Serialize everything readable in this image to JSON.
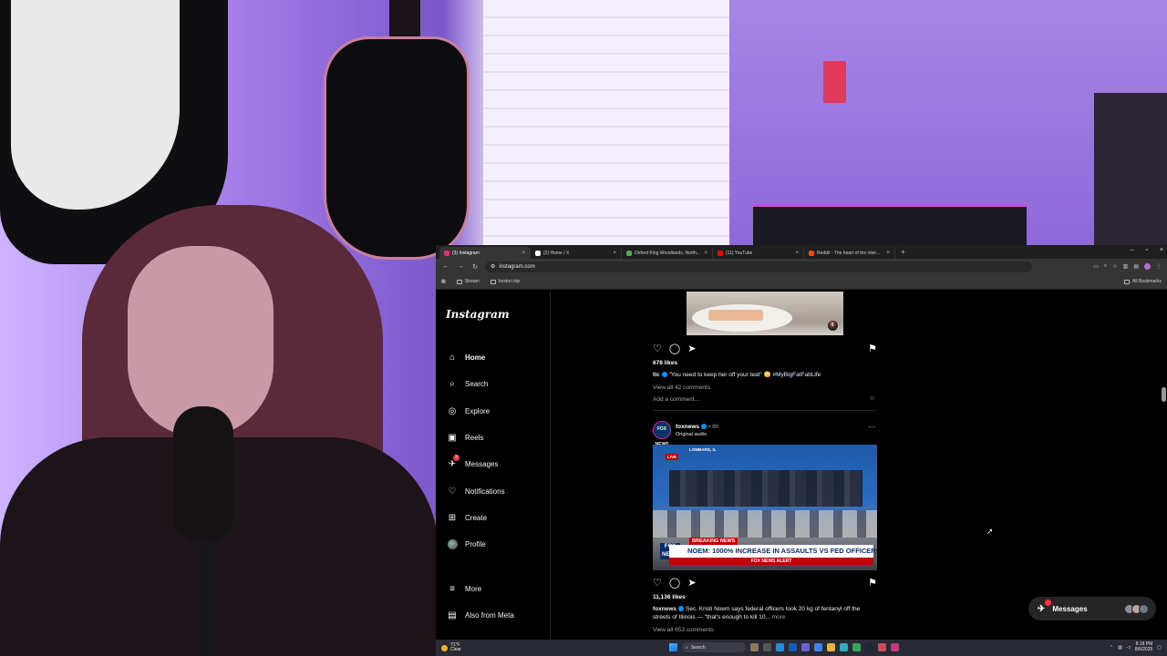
{
  "browser": {
    "tabs": [
      {
        "label": "(3) Instagram",
        "color": "#e1306c",
        "active": true
      },
      {
        "label": "(2) Home / X",
        "color": "#ffffff",
        "active": false
      },
      {
        "label": "Oxford King Woodlands, North...",
        "color": "#4caf50",
        "active": false
      },
      {
        "label": "(11) YouTube",
        "color": "#ff0000",
        "active": false
      },
      {
        "label": "Reddit - The heart of the inter...",
        "color": "#ff4500",
        "active": false
      }
    ],
    "url": "instagram.com",
    "bookmarks": [
      {
        "label": "Stream"
      },
      {
        "label": "boston trip"
      }
    ],
    "all_bookmarks": "All Bookmarks"
  },
  "instagram": {
    "logo": "Instagram",
    "nav": [
      {
        "label": "Home",
        "icon": "home-icon",
        "glyph": "⌂",
        "bold": true
      },
      {
        "label": "Search",
        "icon": "search-icon",
        "glyph": "⌕"
      },
      {
        "label": "Explore",
        "icon": "compass-icon",
        "glyph": "◎"
      },
      {
        "label": "Reels",
        "icon": "reels-icon",
        "glyph": "▣"
      },
      {
        "label": "Messages",
        "icon": "messenger-icon",
        "glyph": "✈",
        "badge": "2"
      },
      {
        "label": "Notifications",
        "icon": "heart-icon",
        "glyph": "♡"
      },
      {
        "label": "Create",
        "icon": "plus-square-icon",
        "glyph": "⊞"
      },
      {
        "label": "Profile",
        "icon": "avatar-icon",
        "glyph": ""
      }
    ],
    "bottom_nav": [
      {
        "label": "More",
        "icon": "menu-icon",
        "glyph": "≡"
      },
      {
        "label": "Also from Meta",
        "icon": "meta-icon",
        "glyph": "▤"
      }
    ],
    "post1": {
      "likes": "678 likes",
      "username": "tlc",
      "caption": "\"You need to keep her off your teat\" 😳",
      "hashtag": "#MyBigFatFabLife",
      "view_comments": "View all 42 comments",
      "add_comment": "Add a comment..."
    },
    "post2": {
      "username": "foxnews",
      "time": "• 8h",
      "audio": "Original audio",
      "avatar_text": "FOX NEWS",
      "video": {
        "location": "LOMBARD, IL",
        "live": "LIVE",
        "breaking": "BREAKING NEWS",
        "headline": "NOEM: 1000% INCREASE IN ASSAULTS VS FED OFFICERS",
        "alert": "FOX NEWS ALERT",
        "bug": "FOX NEWS"
      },
      "likes": "11,136 likes",
      "caption": "Sec. Kristi Noem says federal officers took 20 kg of fentanyl off the streets of Illinois — \"that's enough to kill 10...",
      "more": "more",
      "view_comments": "View all 653 comments"
    },
    "messages_pill": {
      "label": "Messages",
      "badge": "3"
    }
  },
  "taskbar": {
    "weather_temp": "71°F",
    "weather_desc": "Clear",
    "search": "Search",
    "time": "8:18 PM",
    "date": "8/6/2025"
  },
  "colors": {
    "instagram_bg": "#000000",
    "browser_chrome": "#353535",
    "notification_red": "#ff3040",
    "verified_blue": "#0095f6"
  }
}
